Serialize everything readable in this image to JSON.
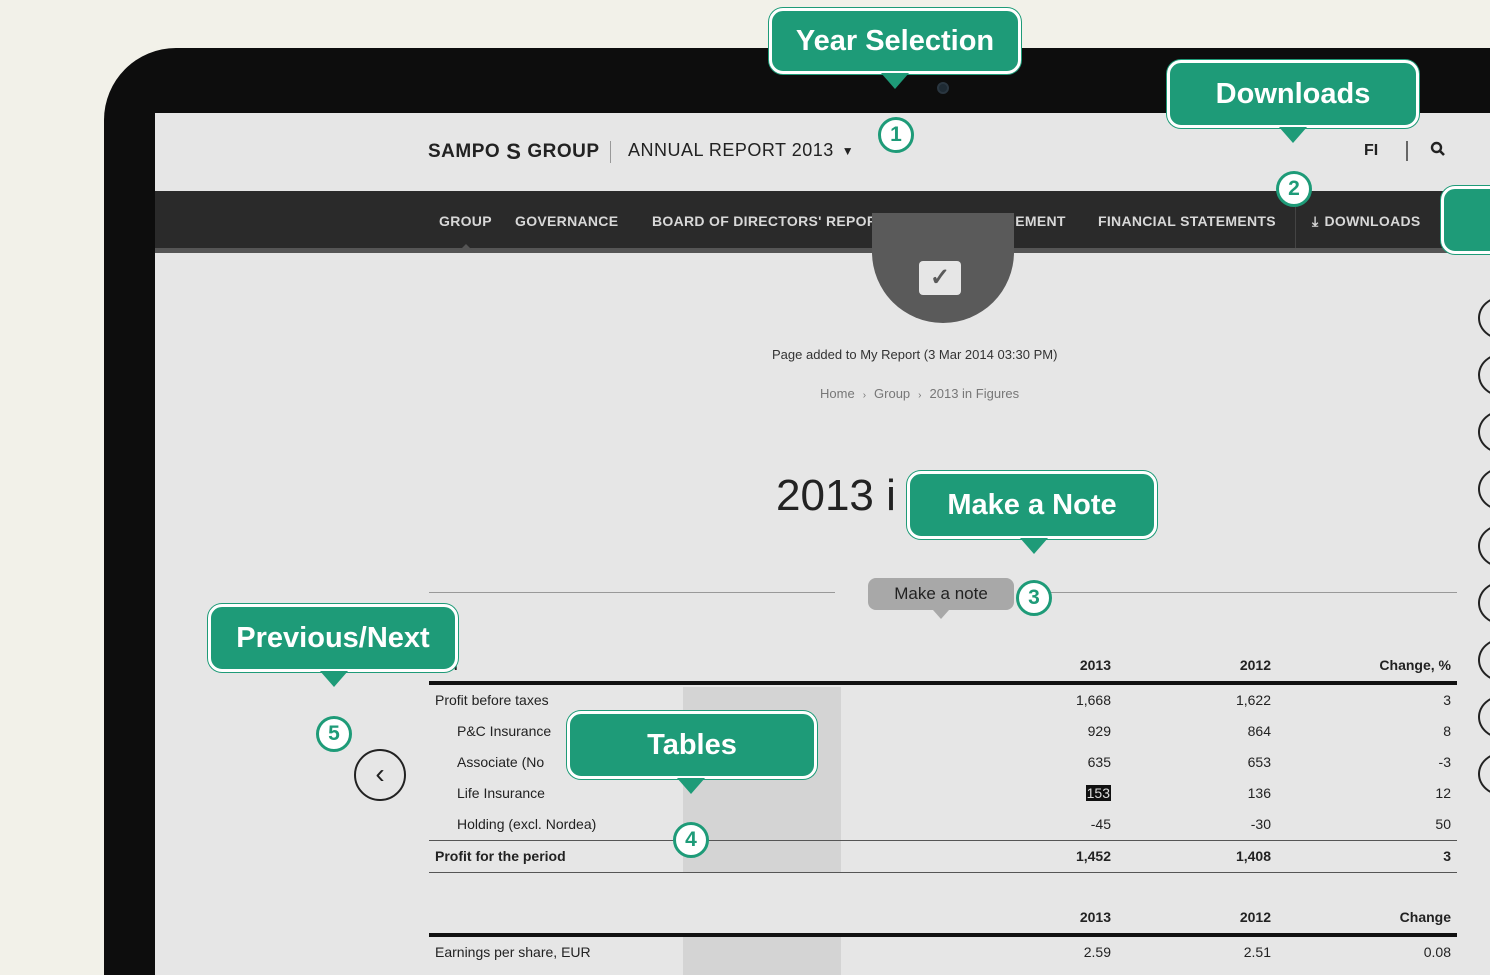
{
  "header": {
    "logo_left": "SAMPO",
    "logo_right": "GROUP",
    "logo_mark": "S",
    "report_title": "ANNUAL REPORT 2013",
    "lang": "FI",
    "search_icon": "search-icon"
  },
  "nav": {
    "items": [
      "GROUP",
      "GOVERNANCE",
      "BOARD OF DIRECTORS' REPORT",
      "RISK MANAGEMENT",
      "FINANCIAL STATEMENTS"
    ],
    "downloads": "DOWNLOADS",
    "downloads_icon": "download-icon"
  },
  "page": {
    "added_message": "Page added to My Report (3 Mar 2014 03:30 PM)",
    "breadcrumb": [
      "Home",
      "Group",
      "2013 in Figures"
    ],
    "breadcrumb_sep": "›",
    "title": "2013 i",
    "make_note": "Make a note",
    "prev_icon": "‹"
  },
  "table1": {
    "headers": {
      "label": "Rm",
      "y2013": "2013",
      "y2012": "2012",
      "change": "Change, %"
    },
    "rows": [
      {
        "label": "Profit before taxes",
        "y2013": "1,668",
        "y2012": "1,622",
        "change": "3",
        "indent": false,
        "bold": false
      },
      {
        "label": "P&C Insurance",
        "y2013": "929",
        "y2012": "864",
        "change": "8",
        "indent": true,
        "bold": false
      },
      {
        "label": "Associate (No",
        "y2013": "635",
        "y2012": "653",
        "change": "-3",
        "indent": true,
        "bold": false
      },
      {
        "label": "Life Insurance",
        "y2013": "153",
        "y2012": "136",
        "change": "12",
        "indent": true,
        "bold": false,
        "selected": true
      },
      {
        "label": "Holding (excl. Nordea)",
        "y2013": "-45",
        "y2012": "-30",
        "change": "50",
        "indent": true,
        "bold": false
      }
    ],
    "total": {
      "label": "Profit for the period",
      "y2013": "1,452",
      "y2012": "1,408",
      "change": "3"
    }
  },
  "table2": {
    "headers": {
      "y2013": "2013",
      "y2012": "2012",
      "change": "Change"
    },
    "rows": [
      {
        "label": "Earnings per share, EUR",
        "y2013": "2.59",
        "y2012": "2.51",
        "change": "0.08"
      }
    ]
  },
  "callouts": {
    "year_selection": "Year Selection",
    "downloads": "Downloads",
    "make_a_note": "Make a Note",
    "previous_next": "Previous/Next",
    "tables": "Tables",
    "numbers": [
      "1",
      "2",
      "3",
      "4",
      "5"
    ]
  },
  "colors": {
    "callout_green": "#1e9b78",
    "nav_bg": "#2a2a2a",
    "screen_bg": "#e6e6e6",
    "page_bg": "#f2f1e9"
  }
}
